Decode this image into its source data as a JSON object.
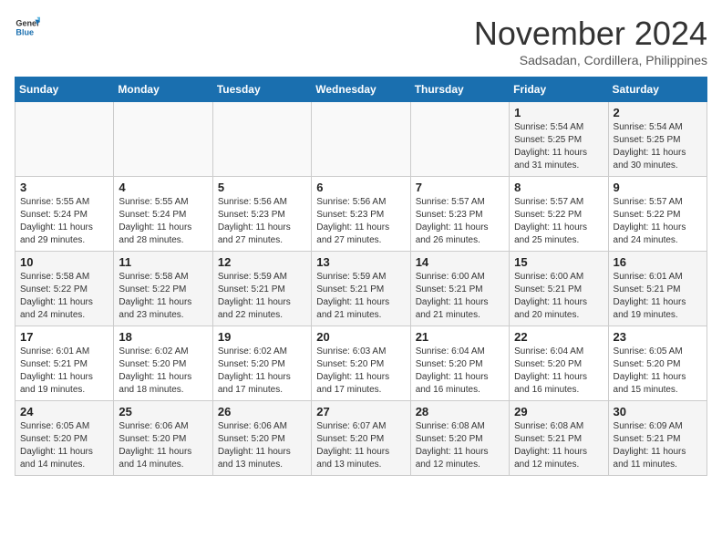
{
  "header": {
    "logo_line1": "General",
    "logo_line2": "Blue",
    "month": "November 2024",
    "location": "Sadsadan, Cordillera, Philippines"
  },
  "weekdays": [
    "Sunday",
    "Monday",
    "Tuesday",
    "Wednesday",
    "Thursday",
    "Friday",
    "Saturday"
  ],
  "weeks": [
    [
      {
        "day": "",
        "info": ""
      },
      {
        "day": "",
        "info": ""
      },
      {
        "day": "",
        "info": ""
      },
      {
        "day": "",
        "info": ""
      },
      {
        "day": "",
        "info": ""
      },
      {
        "day": "1",
        "info": "Sunrise: 5:54 AM\nSunset: 5:25 PM\nDaylight: 11 hours\nand 31 minutes."
      },
      {
        "day": "2",
        "info": "Sunrise: 5:54 AM\nSunset: 5:25 PM\nDaylight: 11 hours\nand 30 minutes."
      }
    ],
    [
      {
        "day": "3",
        "info": "Sunrise: 5:55 AM\nSunset: 5:24 PM\nDaylight: 11 hours\nand 29 minutes."
      },
      {
        "day": "4",
        "info": "Sunrise: 5:55 AM\nSunset: 5:24 PM\nDaylight: 11 hours\nand 28 minutes."
      },
      {
        "day": "5",
        "info": "Sunrise: 5:56 AM\nSunset: 5:23 PM\nDaylight: 11 hours\nand 27 minutes."
      },
      {
        "day": "6",
        "info": "Sunrise: 5:56 AM\nSunset: 5:23 PM\nDaylight: 11 hours\nand 27 minutes."
      },
      {
        "day": "7",
        "info": "Sunrise: 5:57 AM\nSunset: 5:23 PM\nDaylight: 11 hours\nand 26 minutes."
      },
      {
        "day": "8",
        "info": "Sunrise: 5:57 AM\nSunset: 5:22 PM\nDaylight: 11 hours\nand 25 minutes."
      },
      {
        "day": "9",
        "info": "Sunrise: 5:57 AM\nSunset: 5:22 PM\nDaylight: 11 hours\nand 24 minutes."
      }
    ],
    [
      {
        "day": "10",
        "info": "Sunrise: 5:58 AM\nSunset: 5:22 PM\nDaylight: 11 hours\nand 24 minutes."
      },
      {
        "day": "11",
        "info": "Sunrise: 5:58 AM\nSunset: 5:22 PM\nDaylight: 11 hours\nand 23 minutes."
      },
      {
        "day": "12",
        "info": "Sunrise: 5:59 AM\nSunset: 5:21 PM\nDaylight: 11 hours\nand 22 minutes."
      },
      {
        "day": "13",
        "info": "Sunrise: 5:59 AM\nSunset: 5:21 PM\nDaylight: 11 hours\nand 21 minutes."
      },
      {
        "day": "14",
        "info": "Sunrise: 6:00 AM\nSunset: 5:21 PM\nDaylight: 11 hours\nand 21 minutes."
      },
      {
        "day": "15",
        "info": "Sunrise: 6:00 AM\nSunset: 5:21 PM\nDaylight: 11 hours\nand 20 minutes."
      },
      {
        "day": "16",
        "info": "Sunrise: 6:01 AM\nSunset: 5:21 PM\nDaylight: 11 hours\nand 19 minutes."
      }
    ],
    [
      {
        "day": "17",
        "info": "Sunrise: 6:01 AM\nSunset: 5:21 PM\nDaylight: 11 hours\nand 19 minutes."
      },
      {
        "day": "18",
        "info": "Sunrise: 6:02 AM\nSunset: 5:20 PM\nDaylight: 11 hours\nand 18 minutes."
      },
      {
        "day": "19",
        "info": "Sunrise: 6:02 AM\nSunset: 5:20 PM\nDaylight: 11 hours\nand 17 minutes."
      },
      {
        "day": "20",
        "info": "Sunrise: 6:03 AM\nSunset: 5:20 PM\nDaylight: 11 hours\nand 17 minutes."
      },
      {
        "day": "21",
        "info": "Sunrise: 6:04 AM\nSunset: 5:20 PM\nDaylight: 11 hours\nand 16 minutes."
      },
      {
        "day": "22",
        "info": "Sunrise: 6:04 AM\nSunset: 5:20 PM\nDaylight: 11 hours\nand 16 minutes."
      },
      {
        "day": "23",
        "info": "Sunrise: 6:05 AM\nSunset: 5:20 PM\nDaylight: 11 hours\nand 15 minutes."
      }
    ],
    [
      {
        "day": "24",
        "info": "Sunrise: 6:05 AM\nSunset: 5:20 PM\nDaylight: 11 hours\nand 14 minutes."
      },
      {
        "day": "25",
        "info": "Sunrise: 6:06 AM\nSunset: 5:20 PM\nDaylight: 11 hours\nand 14 minutes."
      },
      {
        "day": "26",
        "info": "Sunrise: 6:06 AM\nSunset: 5:20 PM\nDaylight: 11 hours\nand 13 minutes."
      },
      {
        "day": "27",
        "info": "Sunrise: 6:07 AM\nSunset: 5:20 PM\nDaylight: 11 hours\nand 13 minutes."
      },
      {
        "day": "28",
        "info": "Sunrise: 6:08 AM\nSunset: 5:20 PM\nDaylight: 11 hours\nand 12 minutes."
      },
      {
        "day": "29",
        "info": "Sunrise: 6:08 AM\nSunset: 5:21 PM\nDaylight: 11 hours\nand 12 minutes."
      },
      {
        "day": "30",
        "info": "Sunrise: 6:09 AM\nSunset: 5:21 PM\nDaylight: 11 hours\nand 11 minutes."
      }
    ]
  ]
}
